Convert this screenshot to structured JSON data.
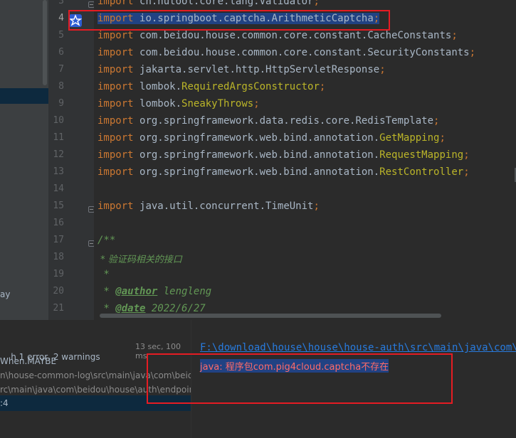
{
  "left_panel": {
    "fragment": "ay"
  },
  "editor": {
    "lines": [
      {
        "n": "3",
        "kw": "import",
        "pkg": "cn.hutool.core.lang.",
        "cls": "Validator",
        "semi": ";"
      },
      {
        "n": "4",
        "kw": "import",
        "pkg": "io.springboot.captcha.",
        "cls": "ArithmeticCaptcha",
        "semi": ";"
      },
      {
        "n": "5",
        "kw": "import",
        "pkg": "com.beidou.house.common.core.constant.",
        "cls": "CacheConstants",
        "semi": ";"
      },
      {
        "n": "6",
        "kw": "import",
        "pkg": "com.beidou.house.common.core.constant.",
        "cls": "SecurityConstants",
        "semi": ";"
      },
      {
        "n": "7",
        "kw": "import",
        "pkg": "jakarta.servlet.http.",
        "cls": "HttpServletResponse",
        "semi": ";"
      },
      {
        "n": "8",
        "kw": "import",
        "pkg": "lombok.",
        "cls": "RequiredArgsConstructor",
        "semi": ";"
      },
      {
        "n": "9",
        "kw": "import",
        "pkg": "lombok.",
        "cls": "SneakyThrows",
        "semi": ";"
      },
      {
        "n": "10",
        "kw": "import",
        "pkg": "org.springframework.data.redis.core.",
        "cls": "RedisTemplate",
        "semi": ";"
      },
      {
        "n": "11",
        "kw": "import",
        "pkg": "org.springframework.web.bind.annotation.",
        "cls": "GetMapping",
        "semi": ";"
      },
      {
        "n": "12",
        "kw": "import",
        "pkg": "org.springframework.web.bind.annotation.",
        "cls": "RequestMapping",
        "semi": ";"
      },
      {
        "n": "13",
        "kw": "import",
        "pkg": "org.springframework.web.bind.annotation.",
        "cls": "RestController",
        "semi": ";"
      },
      {
        "n": "14"
      },
      {
        "n": "15",
        "kw": "import",
        "pkg": "java.util.concurrent.",
        "cls": "TimeUnit",
        "semi": ";"
      },
      {
        "n": "16"
      },
      {
        "n": "17",
        "comment": "/**"
      },
      {
        "n": "18",
        "comment": " * 验证码相关的接口"
      },
      {
        "n": "19",
        "comment": " *"
      },
      {
        "n": "20",
        "comment": " * ",
        "tag": "@author",
        "tagval": " lengleng"
      },
      {
        "n": "21",
        "comment": " * ",
        "tag": "@date",
        "tagval": " 2022/6/27"
      }
    ]
  },
  "build": {
    "summary": "h 1 error, 2 warnings",
    "time": "13 sec, 100 ms",
    "items": [
      "When.MAYBE",
      "n\\house-common-log\\src\\main\\java\\com\\beidou",
      "rc\\main\\java\\com\\beidou\\house\\auth\\endpoint",
      ":4"
    ]
  },
  "output": {
    "path": "F:\\download\\house\\house\\house-auth\\src\\main\\java\\com\\be",
    "error": "java: 程序包com.pig4cloud.captcha不存在"
  }
}
